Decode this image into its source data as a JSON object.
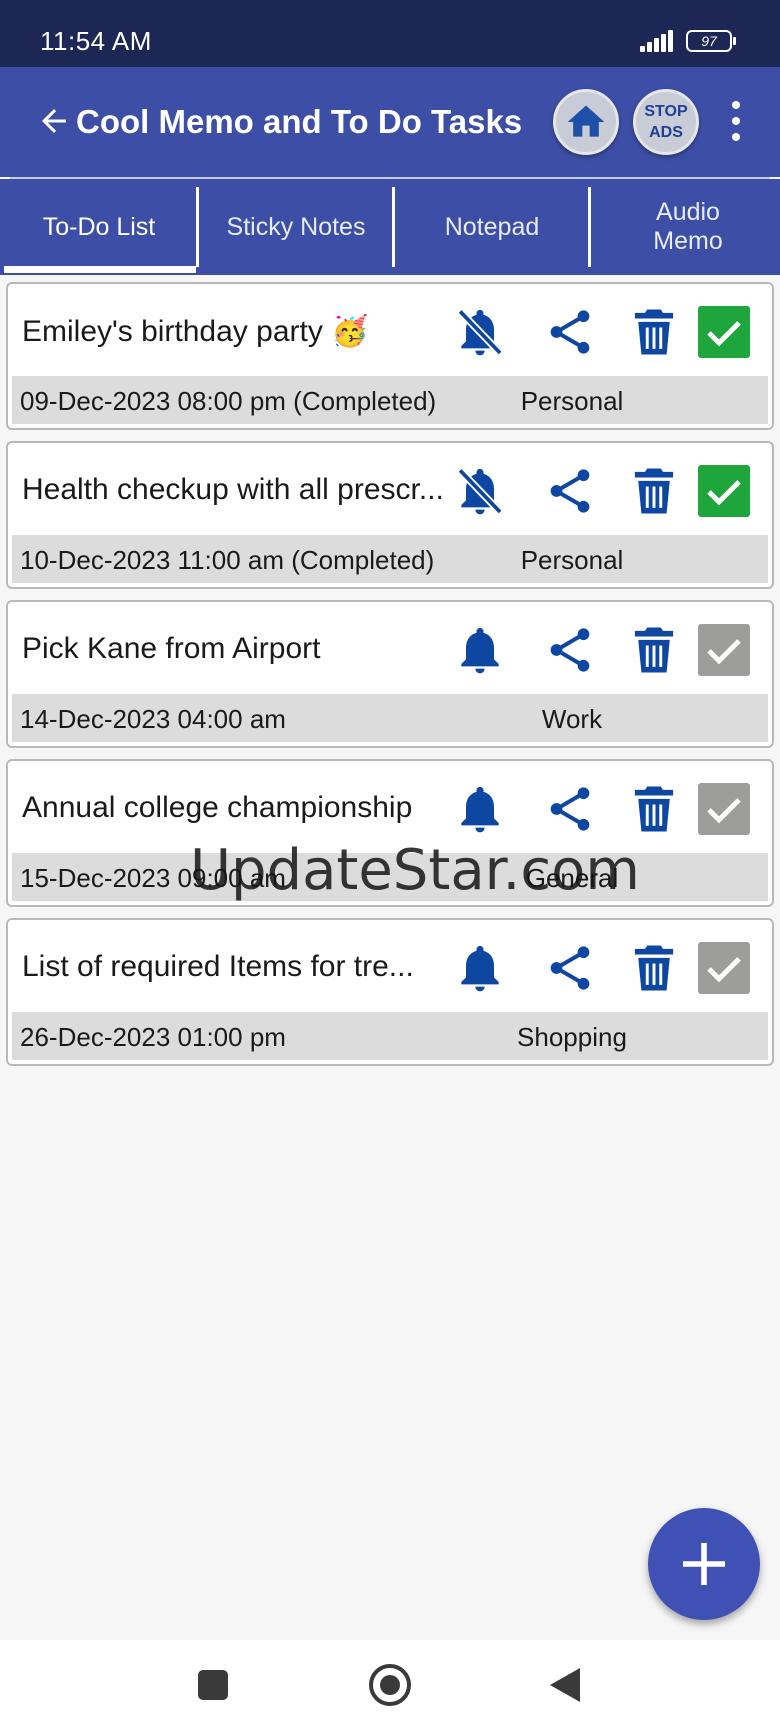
{
  "status_bar": {
    "time": "11:54 AM",
    "battery": "97"
  },
  "app_bar": {
    "title": "Cool Memo and To Do Tasks",
    "home_icon": "home-icon",
    "stop_ads_line1": "STOP",
    "stop_ads_line2": "ADS"
  },
  "tabs": [
    {
      "label": "To-Do List",
      "selected": true
    },
    {
      "label": "Sticky Notes",
      "selected": false
    },
    {
      "label": "Notepad",
      "selected": false
    },
    {
      "label": "Audio Memo",
      "selected": false
    }
  ],
  "tasks": [
    {
      "title": "Emiley's birthday party 🥳",
      "datetime": "09-Dec-2023 08:00 pm (Completed)",
      "category": "Personal",
      "reminder": "bell-off-icon",
      "completed": true
    },
    {
      "title": "Health checkup with all prescr...",
      "datetime": "10-Dec-2023 11:00 am (Completed)",
      "category": "Personal",
      "reminder": "bell-off-icon",
      "completed": true
    },
    {
      "title": "Pick Kane from Airport",
      "datetime": "14-Dec-2023 04:00 am",
      "category": "Work",
      "reminder": "bell-icon",
      "completed": false
    },
    {
      "title": "Annual college championship",
      "datetime": "15-Dec-2023 09:00 am",
      "category": "General",
      "reminder": "bell-icon",
      "completed": false
    },
    {
      "title": "List of required Items for tre...",
      "datetime": "26-Dec-2023 01:00 pm",
      "category": "Shopping",
      "reminder": "bell-icon",
      "completed": false
    }
  ],
  "watermark": "UpdateStar.com",
  "colors": {
    "status_bar": "#1c2755",
    "app_bar": "#3d4ea6",
    "icon_blue": "#0d47a1",
    "check_on": "#1ea53b",
    "check_off": "#9d9e9b",
    "fab": "#3f51b5"
  }
}
